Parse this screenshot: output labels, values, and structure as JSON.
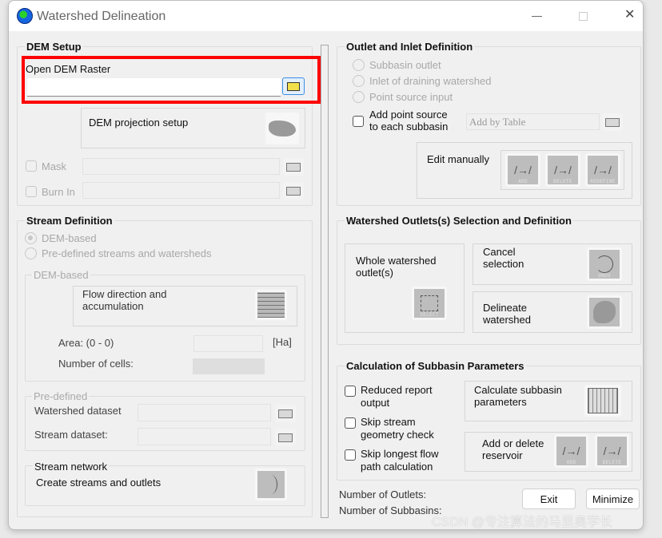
{
  "window": {
    "title": "Watershed Delineation",
    "minimize_glyph": "—",
    "close_glyph": "✕"
  },
  "dem_setup": {
    "title": "DEM Setup",
    "open_dem_label": "Open DEM Raster",
    "open_dem_value": "",
    "projection_label": "DEM projection setup",
    "mask_label": "Mask",
    "burn_in_label": "Burn In",
    "highlight_color": "#ff0000"
  },
  "stream_definition": {
    "title": "Stream Definition",
    "radio_dem": "DEM-based",
    "radio_predefined": "Pre-defined streams and watersheds",
    "dem_based": {
      "title": "DEM-based",
      "flow_label": "Flow direction and accumulation",
      "area_label": "Area: (0 - 0)",
      "area_unit": "[Ha]",
      "cells_label": "Number of cells:"
    },
    "predefined": {
      "title": "Pre-defined",
      "watershed_label": "Watershed dataset",
      "stream_label": "Stream dataset:"
    },
    "network": {
      "title": "Stream network",
      "create_label": "Create streams and outlets"
    }
  },
  "outlet_inlet": {
    "title": "Outlet and Inlet Definition",
    "radio_subbasin": "Subbasin outlet",
    "radio_inlet": "Inlet of draining watershed",
    "radio_point": "Point source input",
    "add_point_line1": "Add point source",
    "add_point_line2": "to each subbasin",
    "add_by_table_placeholder": "Add by Table",
    "edit_manually": "Edit manually",
    "icons": {
      "add": "ADD",
      "delete": "DELETE",
      "redefine": "REDEFINE"
    }
  },
  "outlets_selection": {
    "title": "Watershed Outlets(s) Selection and Definition",
    "whole_label": "Whole watershed outlet(s)",
    "select_caption": "SELECT",
    "cancel_label": "Cancel selection",
    "undo_caption": "UNDO",
    "delineate_label": "Delineate watershed"
  },
  "subbasin_params": {
    "title": "Calculation of Subbasin Parameters",
    "reduced_report": "Reduced  report output",
    "skip_stream": "Skip stream geometry check",
    "skip_longest": "Skip longest flow path calculation",
    "calculate_label": "Calculate subbasin parameters",
    "reservoir_label": "Add or delete reservoir",
    "add_caption": "ADD",
    "delete_caption": "DELETE"
  },
  "footer": {
    "outlets_label": "Number of Outlets:",
    "subbasins_label": "Number of Subbasins:",
    "exit": "Exit",
    "minimize": "Minimize"
  },
  "watermark": "CSDN @专注算法的马里奥学长"
}
